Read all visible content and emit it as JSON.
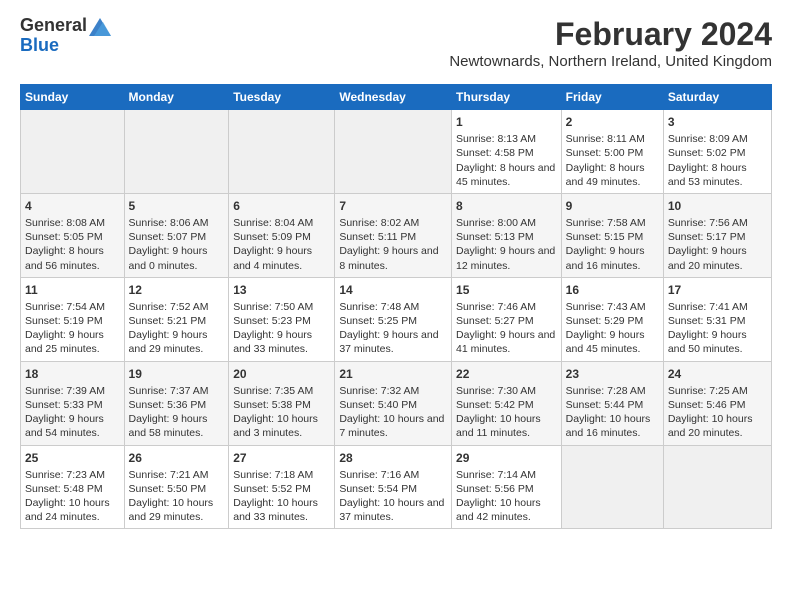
{
  "header": {
    "logo_general": "General",
    "logo_blue": "Blue",
    "title": "February 2024",
    "subtitle": "Newtownards, Northern Ireland, United Kingdom"
  },
  "days_of_week": [
    "Sunday",
    "Monday",
    "Tuesday",
    "Wednesday",
    "Thursday",
    "Friday",
    "Saturday"
  ],
  "weeks": [
    [
      {
        "day": "",
        "content": ""
      },
      {
        "day": "",
        "content": ""
      },
      {
        "day": "",
        "content": ""
      },
      {
        "day": "",
        "content": ""
      },
      {
        "day": "1",
        "content": "Sunrise: 8:13 AM\nSunset: 4:58 PM\nDaylight: 8 hours and 45 minutes."
      },
      {
        "day": "2",
        "content": "Sunrise: 8:11 AM\nSunset: 5:00 PM\nDaylight: 8 hours and 49 minutes."
      },
      {
        "day": "3",
        "content": "Sunrise: 8:09 AM\nSunset: 5:02 PM\nDaylight: 8 hours and 53 minutes."
      }
    ],
    [
      {
        "day": "4",
        "content": "Sunrise: 8:08 AM\nSunset: 5:05 PM\nDaylight: 8 hours and 56 minutes."
      },
      {
        "day": "5",
        "content": "Sunrise: 8:06 AM\nSunset: 5:07 PM\nDaylight: 9 hours and 0 minutes."
      },
      {
        "day": "6",
        "content": "Sunrise: 8:04 AM\nSunset: 5:09 PM\nDaylight: 9 hours and 4 minutes."
      },
      {
        "day": "7",
        "content": "Sunrise: 8:02 AM\nSunset: 5:11 PM\nDaylight: 9 hours and 8 minutes."
      },
      {
        "day": "8",
        "content": "Sunrise: 8:00 AM\nSunset: 5:13 PM\nDaylight: 9 hours and 12 minutes."
      },
      {
        "day": "9",
        "content": "Sunrise: 7:58 AM\nSunset: 5:15 PM\nDaylight: 9 hours and 16 minutes."
      },
      {
        "day": "10",
        "content": "Sunrise: 7:56 AM\nSunset: 5:17 PM\nDaylight: 9 hours and 20 minutes."
      }
    ],
    [
      {
        "day": "11",
        "content": "Sunrise: 7:54 AM\nSunset: 5:19 PM\nDaylight: 9 hours and 25 minutes."
      },
      {
        "day": "12",
        "content": "Sunrise: 7:52 AM\nSunset: 5:21 PM\nDaylight: 9 hours and 29 minutes."
      },
      {
        "day": "13",
        "content": "Sunrise: 7:50 AM\nSunset: 5:23 PM\nDaylight: 9 hours and 33 minutes."
      },
      {
        "day": "14",
        "content": "Sunrise: 7:48 AM\nSunset: 5:25 PM\nDaylight: 9 hours and 37 minutes."
      },
      {
        "day": "15",
        "content": "Sunrise: 7:46 AM\nSunset: 5:27 PM\nDaylight: 9 hours and 41 minutes."
      },
      {
        "day": "16",
        "content": "Sunrise: 7:43 AM\nSunset: 5:29 PM\nDaylight: 9 hours and 45 minutes."
      },
      {
        "day": "17",
        "content": "Sunrise: 7:41 AM\nSunset: 5:31 PM\nDaylight: 9 hours and 50 minutes."
      }
    ],
    [
      {
        "day": "18",
        "content": "Sunrise: 7:39 AM\nSunset: 5:33 PM\nDaylight: 9 hours and 54 minutes."
      },
      {
        "day": "19",
        "content": "Sunrise: 7:37 AM\nSunset: 5:36 PM\nDaylight: 9 hours and 58 minutes."
      },
      {
        "day": "20",
        "content": "Sunrise: 7:35 AM\nSunset: 5:38 PM\nDaylight: 10 hours and 3 minutes."
      },
      {
        "day": "21",
        "content": "Sunrise: 7:32 AM\nSunset: 5:40 PM\nDaylight: 10 hours and 7 minutes."
      },
      {
        "day": "22",
        "content": "Sunrise: 7:30 AM\nSunset: 5:42 PM\nDaylight: 10 hours and 11 minutes."
      },
      {
        "day": "23",
        "content": "Sunrise: 7:28 AM\nSunset: 5:44 PM\nDaylight: 10 hours and 16 minutes."
      },
      {
        "day": "24",
        "content": "Sunrise: 7:25 AM\nSunset: 5:46 PM\nDaylight: 10 hours and 20 minutes."
      }
    ],
    [
      {
        "day": "25",
        "content": "Sunrise: 7:23 AM\nSunset: 5:48 PM\nDaylight: 10 hours and 24 minutes."
      },
      {
        "day": "26",
        "content": "Sunrise: 7:21 AM\nSunset: 5:50 PM\nDaylight: 10 hours and 29 minutes."
      },
      {
        "day": "27",
        "content": "Sunrise: 7:18 AM\nSunset: 5:52 PM\nDaylight: 10 hours and 33 minutes."
      },
      {
        "day": "28",
        "content": "Sunrise: 7:16 AM\nSunset: 5:54 PM\nDaylight: 10 hours and 37 minutes."
      },
      {
        "day": "29",
        "content": "Sunrise: 7:14 AM\nSunset: 5:56 PM\nDaylight: 10 hours and 42 minutes."
      },
      {
        "day": "",
        "content": ""
      },
      {
        "day": "",
        "content": ""
      }
    ]
  ]
}
